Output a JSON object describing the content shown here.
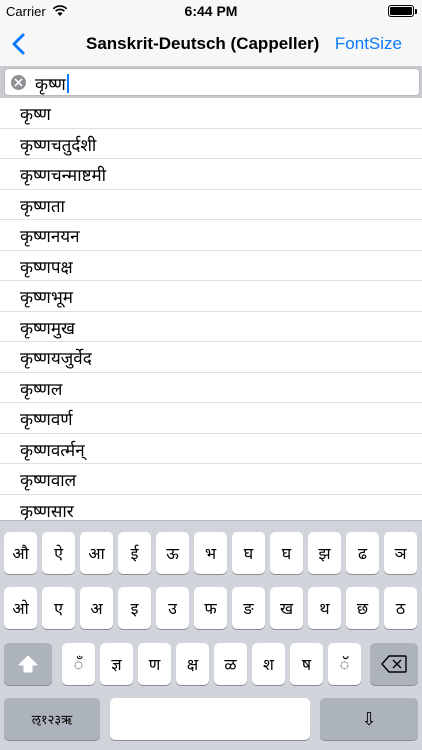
{
  "status": {
    "carrier": "Carrier",
    "time": "6:44 PM"
  },
  "nav": {
    "title": "Sanskrit-Deutsch (Cappeller)",
    "font_size_label": "FontSize"
  },
  "search": {
    "value": "कृष्ण"
  },
  "results": [
    "कृष्ण",
    "कृष्णचतुर्दशी",
    "कृष्णचन्माष्टमी",
    "कृष्णता",
    "कृष्णनयन",
    "कृष्णपक्ष",
    "कृष्णभूम",
    "कृष्णमुख",
    "कृष्णयजुर्वेद",
    "कृष्णल",
    "कृष्णवर्ण",
    "कृष्णवर्त्मन्",
    "कृष्णवाल",
    "कृष्णसार"
  ],
  "keyboard": {
    "row1": [
      "औ",
      "ऐ",
      "आ",
      "ई",
      "ऊ",
      "भ",
      "घ",
      "घ",
      "झ",
      "ढ",
      "ञ"
    ],
    "row2": [
      "ओ",
      "ए",
      "अ",
      "इ",
      "उ",
      "फ",
      "ङ",
      "ख",
      "थ",
      "छ",
      "ठ"
    ],
    "row3": [
      "ँ",
      "ज्ञ",
      "ण",
      "क्ष",
      "ळ",
      "श",
      "ष",
      "ॅ"
    ],
    "mode_label": "ऌ१२३ऋ",
    "return_label": "⇩"
  },
  "colors": {
    "accent": "#0a7aff"
  }
}
